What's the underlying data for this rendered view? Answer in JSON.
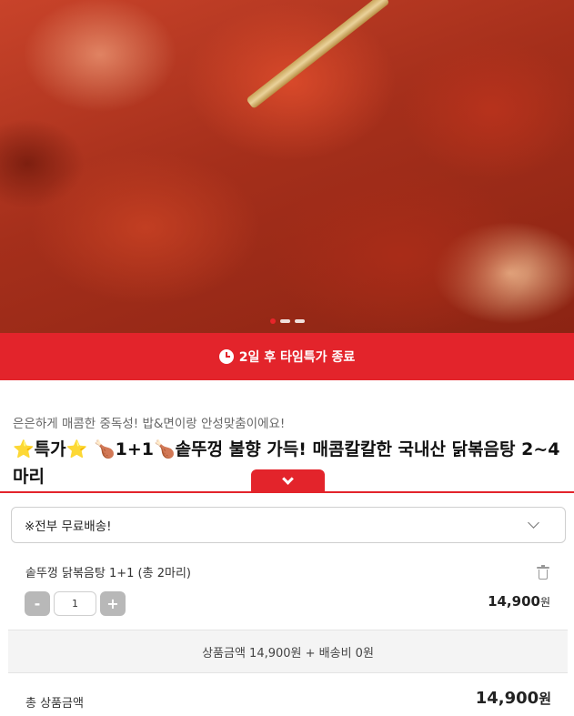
{
  "hero": {
    "image_alt": "spicy braised chicken photo",
    "slide_count": 3,
    "active_slide": 1
  },
  "timer_banner": {
    "text": "2일 후 타임특가 종료",
    "icon": "clock-icon",
    "color": "#e3242b"
  },
  "product": {
    "subtitle": "은은하게 매콤한 중독성! 밥&면이랑 안성맞춤이에요!",
    "title_prefix_star": "⭐",
    "title_special": "특가",
    "title_suffix_star": "⭐",
    "title_leg_1": "🍗",
    "title_promo": "1+1",
    "title_leg_2": "🍗",
    "title_main": "솥뚜껑 불향 가득! 매콤칼칼한 국내산 닭볶음탕 2~4마리"
  },
  "option_select": {
    "selected": "※전부 무료배송!"
  },
  "cart_item": {
    "name": "솥뚜껑 닭볶음탕 1+1 (총 2마리)",
    "minus": "-",
    "quantity": "1",
    "plus": "+",
    "price": "14,900",
    "currency": "원"
  },
  "summary": {
    "text": "상품금액 14,900원 + 배송비 0원"
  },
  "total": {
    "label": "총 상품금액",
    "price": "14,900",
    "currency": "원"
  },
  "colors": {
    "accent": "#e3242b",
    "stepper_gray": "#b8b8b8"
  }
}
